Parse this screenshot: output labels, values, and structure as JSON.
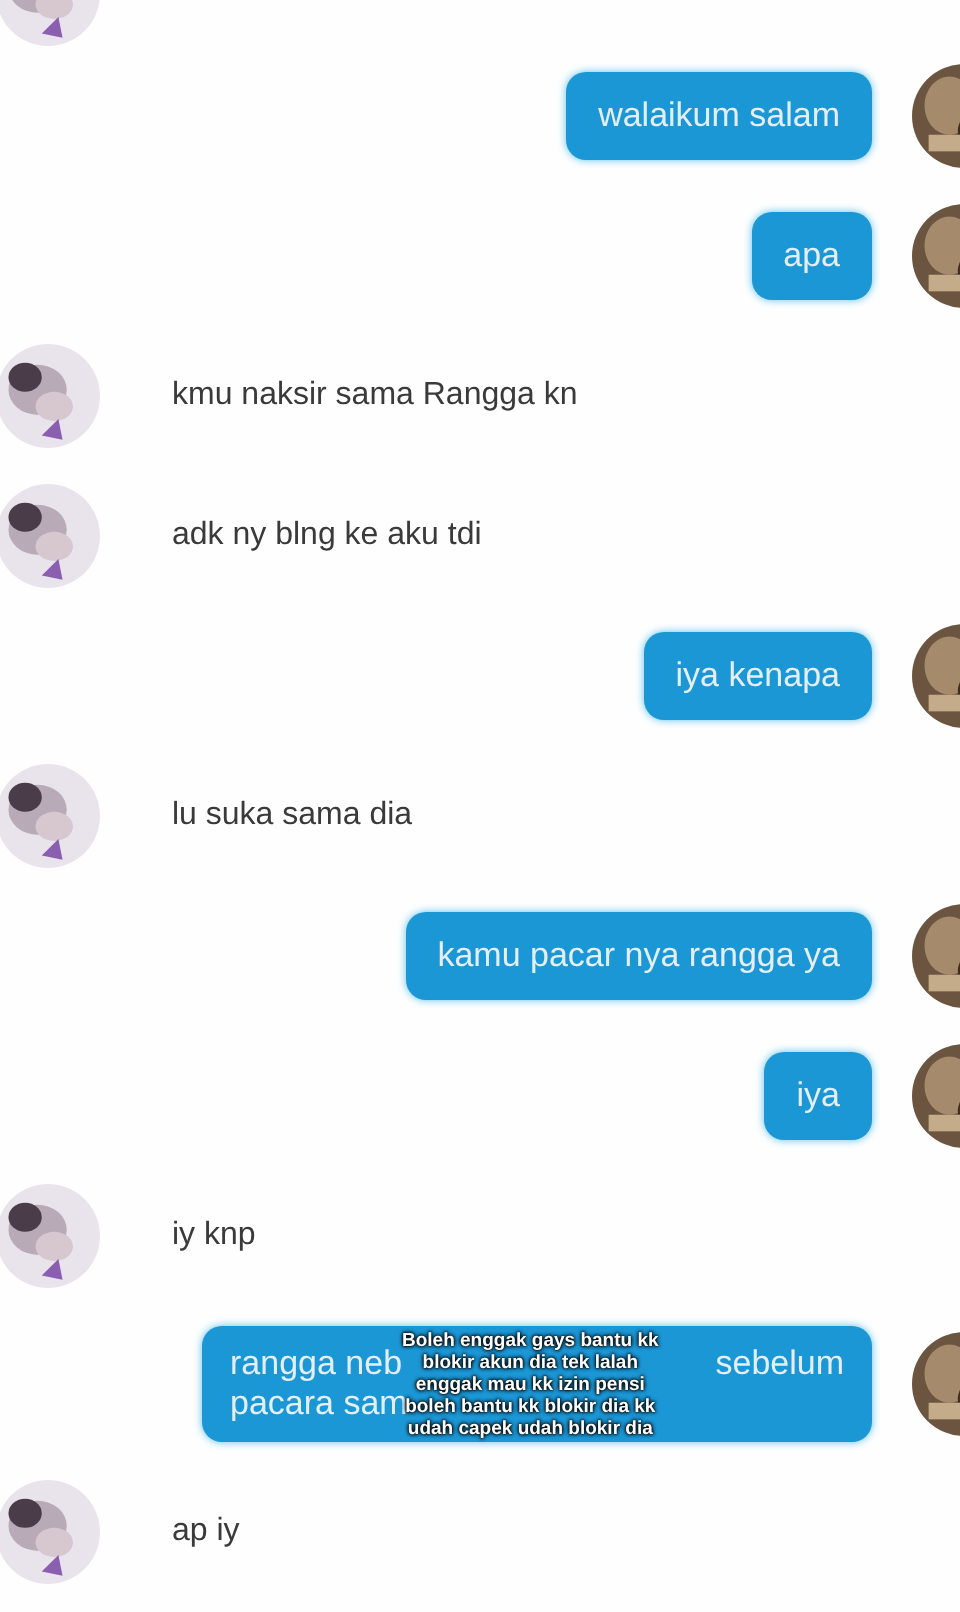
{
  "messages": [
    {
      "kind": "received_avatar"
    },
    {
      "kind": "sent_bubble",
      "lines": [
        [
          "walaikum salam"
        ]
      ]
    },
    {
      "kind": "sent_bubble",
      "lines": [
        [
          "apa"
        ]
      ]
    },
    {
      "kind": "received_text",
      "lines": [
        [
          "kmu naksir sama Rangga kn"
        ]
      ]
    },
    {
      "kind": "received_text",
      "lines": [
        [
          "adk ny blng ke aku tdi"
        ]
      ]
    },
    {
      "kind": "sent_bubble",
      "lines": [
        [
          "iya kenapa"
        ]
      ]
    },
    {
      "kind": "received_text",
      "lines": [
        [
          "lu suka sama dia"
        ]
      ]
    },
    {
      "kind": "sent_bubble",
      "lines": [
        [
          "kamu pacar nya rangga ya"
        ]
      ]
    },
    {
      "kind": "sent_bubble",
      "lines": [
        [
          "iya"
        ]
      ]
    },
    {
      "kind": "received_text",
      "lines": [
        [
          "iy knp"
        ]
      ]
    },
    {
      "kind": "sent_bubble",
      "lines": [
        [
          "rangga neb",
          "sebelum"
        ],
        [
          "pacara sam"
        ]
      ],
      "caption": [
        "Boleh enggak gays bantu kk",
        "blokir akun dia tek lalah",
        "enggak mau kk izin pensi",
        "boleh bantu kk blokir dia kk",
        "udah capek udah blokir dia"
      ]
    },
    {
      "kind": "received_text",
      "lines": [
        [
          "ap iy"
        ]
      ]
    }
  ]
}
